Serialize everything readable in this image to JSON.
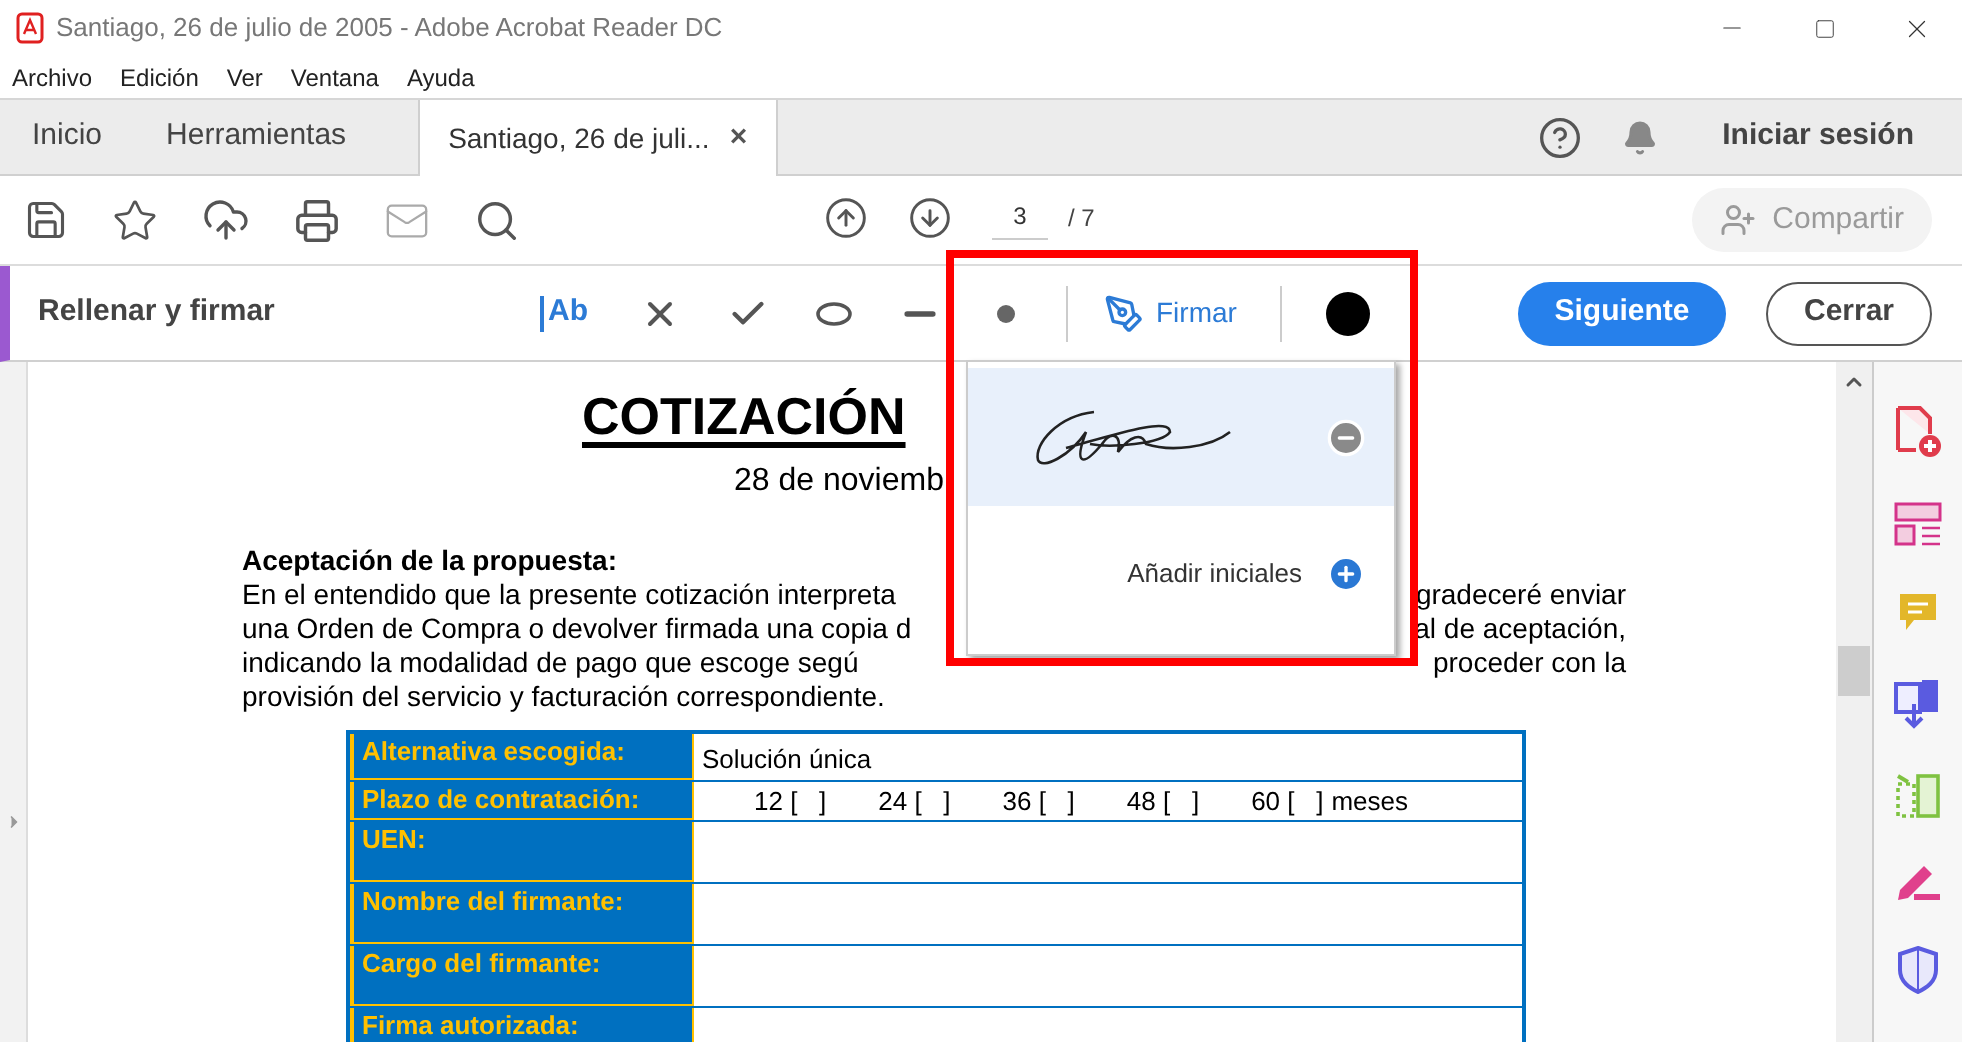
{
  "window": {
    "title": "Santiago, 26 de julio de 2005 - Adobe Acrobat Reader DC"
  },
  "menu": [
    "Archivo",
    "Edición",
    "Ver",
    "Ventana",
    "Ayuda"
  ],
  "tabs": [
    {
      "label": "Inicio",
      "selected": false
    },
    {
      "label": "Herramientas",
      "selected": false
    },
    {
      "label": "Santiago, 26 de juli...",
      "selected": true,
      "close": "×"
    }
  ],
  "account": {
    "sign_in": "Iniciar sesión"
  },
  "toolbar": {
    "page_current": "3",
    "page_total": "/ 7",
    "share": "Compartir"
  },
  "fill_sign_bar": {
    "title": "Rellenar y firmar",
    "text_tool": "Ab",
    "sign": "Firmar",
    "next": "Siguiente",
    "close": "Cerrar"
  },
  "signature_popup": {
    "add_initials": "Añadir iniciales"
  },
  "document": {
    "heading": "COTIZACIÓN",
    "date": "28 de noviemb",
    "section_title": "Aceptación de la propuesta:",
    "lines": [
      {
        "left": "En el entendido que la presente cotización interpreta",
        "right": "gradeceré enviar"
      },
      {
        "left": "una Orden de Compra o devolver firmada una copia d",
        "right": "al de aceptación,"
      },
      {
        "left": "indicando la modalidad de pago que escoge segú",
        "right": "proceder con la"
      },
      {
        "left": "provisión del servicio y facturación correspondiente."
      }
    ],
    "table": {
      "rows": [
        {
          "label": "Alternativa escogida:",
          "value": "Solución única"
        },
        {
          "label": "Plazo de contratación:",
          "options": [
            "12 [   ]",
            "24 [   ]",
            "36 [   ]",
            "48 [   ]",
            "60 [   ]"
          ],
          "suffix": "meses"
        },
        {
          "label": "UEN:"
        },
        {
          "label": "Nombre del firmante:"
        },
        {
          "label": "Cargo del firmante:"
        },
        {
          "label": "Firma autorizada:"
        }
      ]
    }
  }
}
